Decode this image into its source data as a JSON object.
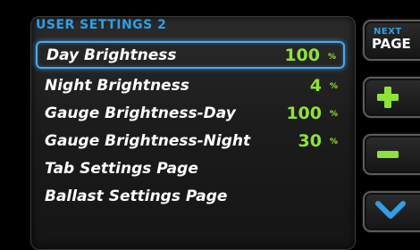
{
  "title": "USER SETTINGS 2",
  "settings": [
    {
      "label": "Day Brightness",
      "value": "100",
      "unit": "%",
      "selected": true
    },
    {
      "label": "Night Brightness",
      "value": "4",
      "unit": "%"
    },
    {
      "label": "Gauge Brightness-Day",
      "value": "100",
      "unit": "%"
    },
    {
      "label": "Gauge Brightness-Night",
      "value": "30",
      "unit": "%"
    },
    {
      "label": "Tab Settings Page",
      "value": "",
      "unit": ""
    },
    {
      "label": "Ballast Settings Page",
      "value": "",
      "unit": ""
    }
  ],
  "buttons": {
    "next_small": "NEXT",
    "next_big": "PAGE",
    "plus_icon": "plus-icon",
    "minus_icon": "minus-icon",
    "down_icon": "chevron-down-icon"
  },
  "colors": {
    "accent_blue": "#2f9fe6",
    "value_green": "#8fe23a",
    "label_white": "#ffffff"
  }
}
